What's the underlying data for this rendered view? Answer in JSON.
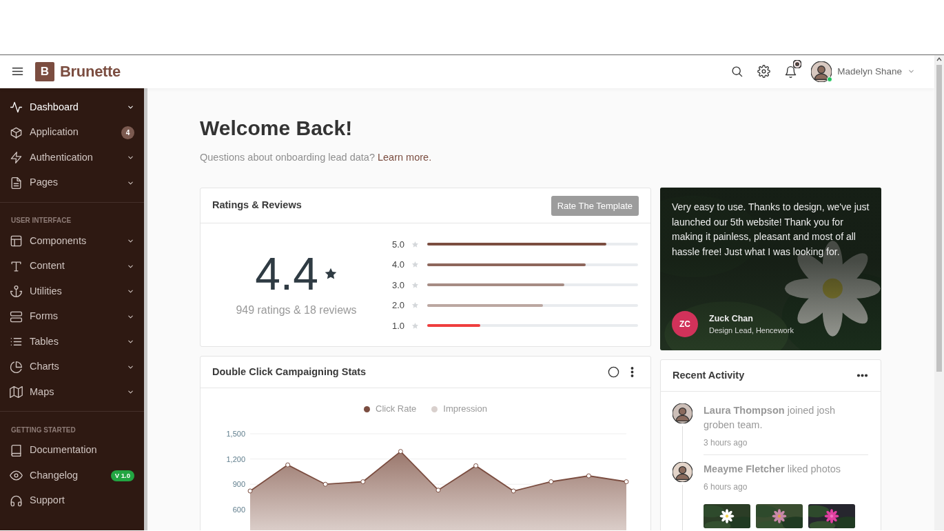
{
  "header": {
    "brand_mark": "B",
    "brand": "Brunette",
    "has_notification": true,
    "user": "Madelyn Shane",
    "online": true
  },
  "sidebar": {
    "sections": [
      {
        "items": [
          {
            "label": "Dashboard",
            "selected": true,
            "submenu": true
          },
          {
            "label": "Application",
            "selected": false,
            "submenu": false,
            "badge": {
              "kind": "count",
              "text": "4"
            }
          },
          {
            "label": "Authentication",
            "selected": false,
            "submenu": true
          },
          {
            "label": "Pages",
            "selected": false,
            "submenu": true
          }
        ]
      },
      {
        "heading": "USER INTERFACE",
        "items": [
          {
            "label": "Components",
            "selected": false,
            "submenu": true
          },
          {
            "label": "Content",
            "selected": false,
            "submenu": true
          },
          {
            "label": "Utilities",
            "selected": false,
            "submenu": true
          },
          {
            "label": "Forms",
            "selected": false,
            "submenu": true
          },
          {
            "label": "Tables",
            "selected": false,
            "submenu": true
          },
          {
            "label": "Charts",
            "selected": false,
            "submenu": true
          },
          {
            "label": "Maps",
            "selected": false,
            "submenu": true
          }
        ]
      },
      {
        "heading": "GETTING STARTED",
        "items": [
          {
            "label": "Documentation",
            "selected": false,
            "submenu": false
          },
          {
            "label": "Changelog",
            "selected": false,
            "submenu": false,
            "badge": {
              "kind": "version",
              "text": "V 1.0"
            }
          },
          {
            "label": "Support",
            "selected": false,
            "submenu": false
          }
        ]
      }
    ]
  },
  "welcome": {
    "title": "Welcome Back!",
    "text": "Questions about onboarding lead data?",
    "link": "Learn more."
  },
  "ratings": {
    "title": "Ratings & Reviews",
    "button": "Rate The Template",
    "score": "4.4",
    "summary": "949 ratings & 18 reviews",
    "rows": [
      {
        "label": "5.0",
        "level": 0.85,
        "color": "#7b4d40"
      },
      {
        "label": "4.0",
        "level": 0.75,
        "color": "#8d665b"
      },
      {
        "label": "3.0",
        "level": 0.65,
        "color": "#a68c84"
      },
      {
        "label": "2.0",
        "level": 0.55,
        "color": "#bba7a1"
      },
      {
        "label": "1.0",
        "level": 0.25,
        "color": "#ef3e3e"
      }
    ]
  },
  "campaign": {
    "title": "Double Click Campaigning Stats",
    "chart_data": {
      "type": "area",
      "ylim": [
        0,
        1500
      ],
      "yticks": [
        {
          "value": 600,
          "label": "600"
        },
        {
          "value": 900,
          "label": "900"
        },
        {
          "value": 1200,
          "label": "1,200"
        },
        {
          "value": 1500,
          "label": "1,500"
        }
      ],
      "series": [
        {
          "name": "Click Rate",
          "color": "#7b4d40",
          "values": [
            820,
            1130,
            900,
            930,
            1290,
            830,
            1120,
            820,
            930,
            1000,
            930
          ]
        },
        {
          "name": "Impression",
          "color": "#d9d0cd",
          "values": [
            null,
            null,
            null,
            null,
            null,
            null,
            null,
            null,
            null,
            null,
            null
          ]
        }
      ]
    }
  },
  "testimonial": {
    "quote": "Very easy to use. Thanks to design, we've just launched our 5th website! Thank you for making it painless, pleasant and most of all hassle free! Just what I was looking for.",
    "initials": "ZC",
    "name": "Zuck Chan",
    "role": "Design Lead, Hencework"
  },
  "activity": {
    "title": "Recent Activity",
    "items": [
      {
        "text": "**Laura Thompson** joined josh groben team.",
        "time": "3 hours ago"
      },
      {
        "text": "**Meayme Fletcher** liked photos",
        "time": "6 hours ago"
      }
    ]
  }
}
